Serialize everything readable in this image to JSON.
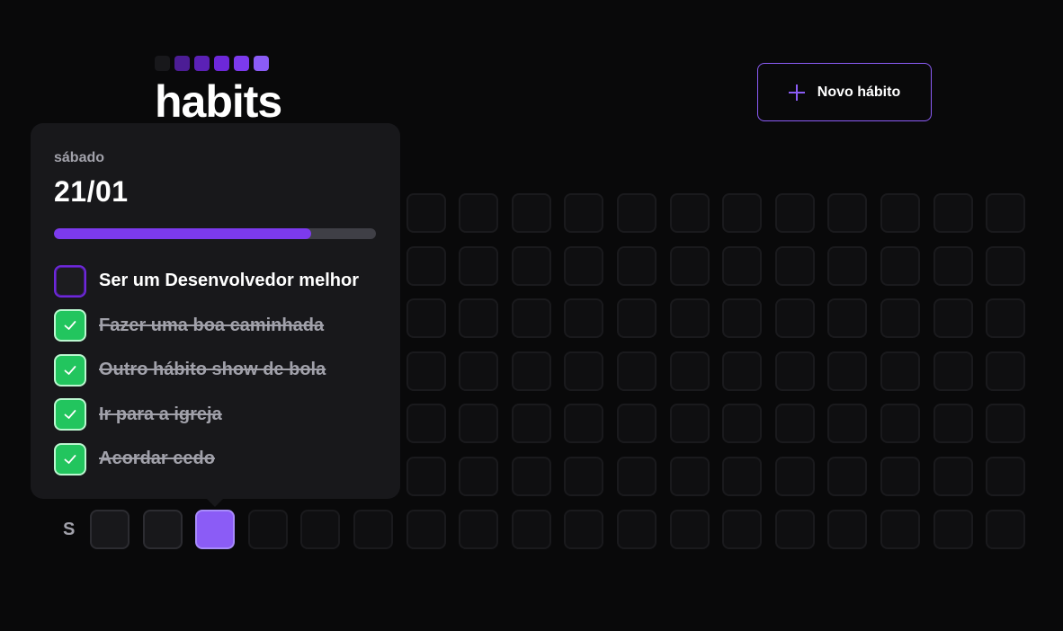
{
  "header": {
    "logo_text": "habits",
    "logo_squares": [
      "#18181b",
      "#4c1d95",
      "#5b21b6",
      "#6d28d9",
      "#7c3aed",
      "#8b5cf6"
    ],
    "new_habit_label": "Novo hábito",
    "new_habit_icon": "plus-icon"
  },
  "summary": {
    "weekday_label": "S",
    "columns": 18,
    "rows": 7,
    "active_cell": {
      "row": 6,
      "col": 2
    },
    "past_cells_last_row": 2
  },
  "popover": {
    "weekday": "sábado",
    "date": "21/01",
    "progress": 0.8,
    "habits": [
      {
        "label": "Ser um Desenvolvedor melhor",
        "completed": false
      },
      {
        "label": "Fazer uma boa caminhada",
        "completed": true
      },
      {
        "label": "Outro hábito show de bola",
        "completed": true
      },
      {
        "label": "Ir para a igreja",
        "completed": true
      },
      {
        "label": "Acordar cedo",
        "completed": true
      }
    ]
  },
  "colors": {
    "accent": "#8b5cf6",
    "progress": "#7c3aed",
    "check": "#22c55e",
    "background": "#09090a",
    "panel": "#18181b"
  }
}
